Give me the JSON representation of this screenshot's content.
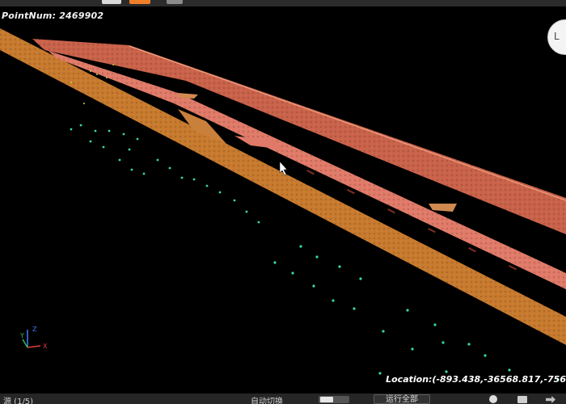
{
  "viewer": {
    "point_count_label": "PointNum: 2469902",
    "location_label": "Location:(-893.438,-36568.817,-756",
    "view_cube_letter": "L"
  },
  "axes": {
    "x": "X",
    "y": "Y",
    "z": "Z"
  },
  "colors": {
    "ground_strip": "#c97a2a",
    "platform_top": "#d86850",
    "platform_inner": "#f08070",
    "rail_points": "#38d6b0"
  },
  "bottom_bar": {
    "status_text": "源 (1/5)",
    "switch_label": "自动切换",
    "run_all_label": "运行全部"
  }
}
